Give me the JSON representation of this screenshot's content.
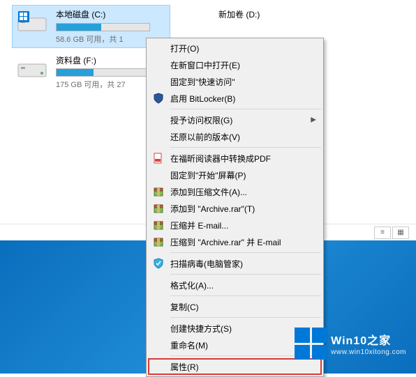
{
  "drives": [
    {
      "name": "本地磁盘 (C:)",
      "stats": "58.6 GB 可用，共 1",
      "fill": 48,
      "selected": true
    },
    {
      "name": "新加卷 (D:)",
      "stats": "",
      "fill": 0,
      "selected": false
    },
    {
      "name": "资料盘 (F:)",
      "stats": "175 GB 可用，共 27",
      "fill": 40,
      "selected": false
    }
  ],
  "menu": {
    "open": "打开(O)",
    "open_new_window": "在新窗口中打开(E)",
    "pin_quick": "固定到\"快速访问\"",
    "bitlocker": "启用 BitLocker(B)",
    "grant_access": "授予访问权限(G)",
    "restore_prev": "还原以前的版本(V)",
    "foxit": "在福昕阅读器中转换成PDF",
    "pin_start": "固定到\"开始\"屏幕(P)",
    "zip_add": "添加到压缩文件(A)...",
    "zip_archive": "添加到 \"Archive.rar\"(T)",
    "zip_email": "压缩并 E-mail...",
    "zip_archive_email": "压缩到 \"Archive.rar\" 并 E-mail",
    "scan_virus": "扫描病毒(电脑管家)",
    "format": "格式化(A)...",
    "copy": "复制(C)",
    "create_shortcut": "创建快捷方式(S)",
    "rename": "重命名(M)",
    "properties": "属性(R)"
  },
  "watermark": {
    "brand": "Win10",
    "suffix": "之家",
    "url": "www.win10xitong.com"
  }
}
